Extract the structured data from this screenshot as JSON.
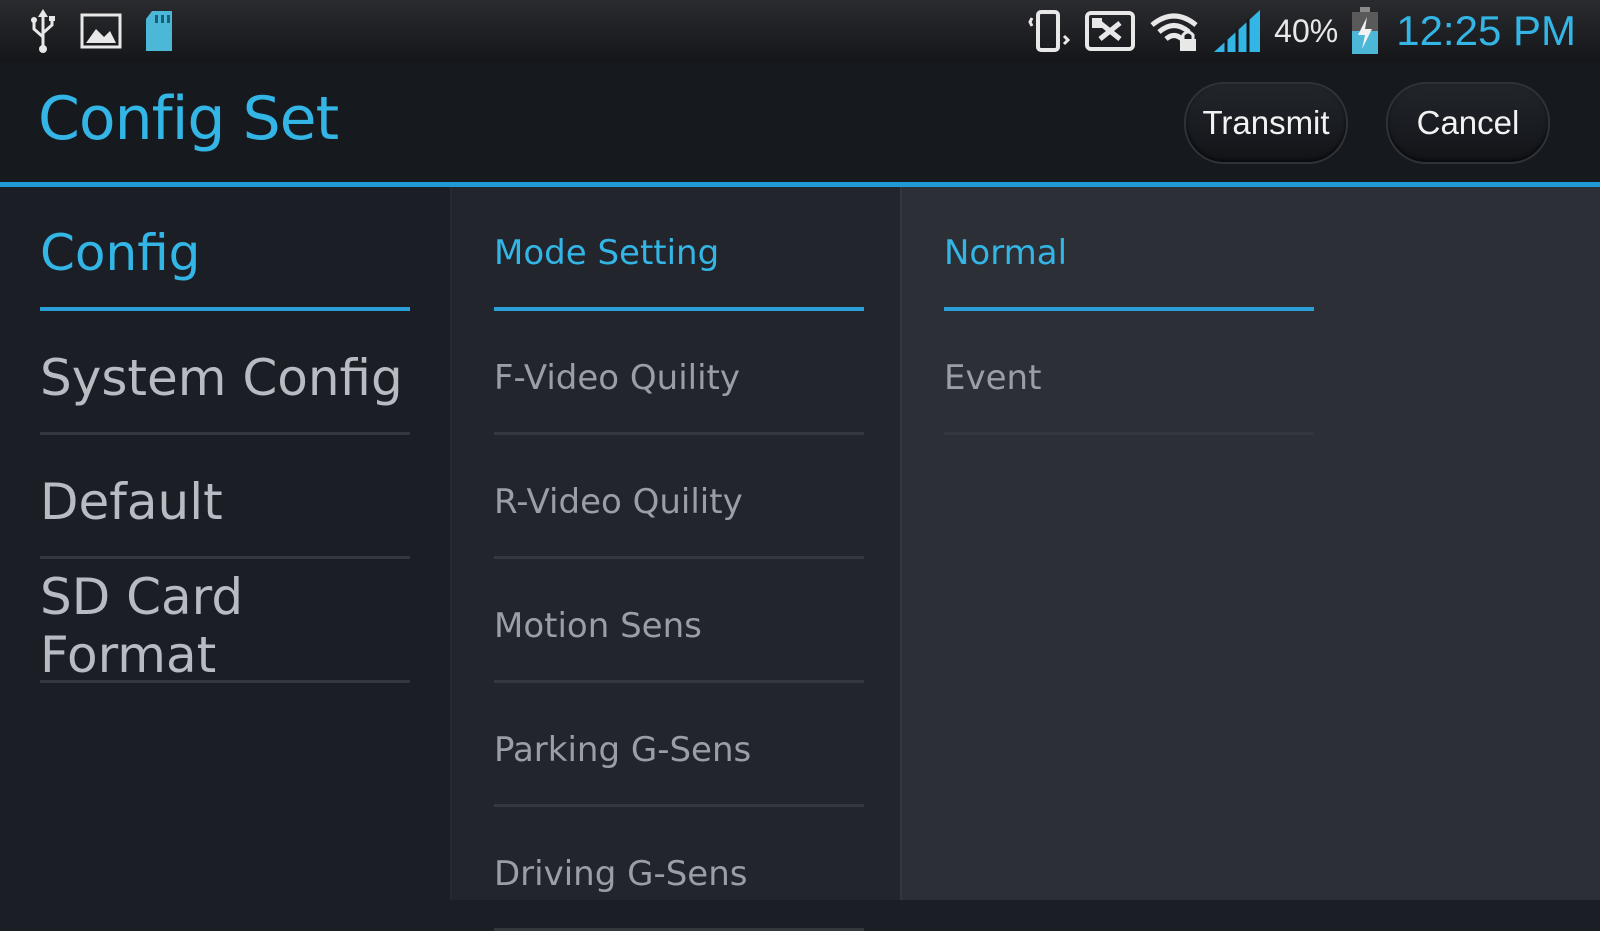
{
  "status_bar": {
    "left_icons": [
      "usb-icon",
      "image-icon",
      "sd-card-icon"
    ],
    "right_icons": [
      "vibrate-icon",
      "screen-off-icon",
      "wifi-lock-icon",
      "signal-icon",
      "battery-charging-icon"
    ],
    "battery_percent": "40%",
    "time": "12:25 PM"
  },
  "action_bar": {
    "title": "Config Set",
    "transmit_label": "Transmit",
    "cancel_label": "Cancel"
  },
  "categories": {
    "items": [
      {
        "label": "Config",
        "selected": true
      },
      {
        "label": "System Config",
        "selected": false
      },
      {
        "label": "Default",
        "selected": false
      },
      {
        "label": "SD Card Format",
        "selected": false
      }
    ]
  },
  "settings": {
    "items": [
      {
        "label": "Mode Setting",
        "selected": true
      },
      {
        "label": "F-Video Quility",
        "selected": false
      },
      {
        "label": "R-Video Quility",
        "selected": false
      },
      {
        "label": "Motion Sens",
        "selected": false
      },
      {
        "label": "Parking G-Sens",
        "selected": false
      },
      {
        "label": "Driving G-Sens",
        "selected": false
      }
    ]
  },
  "options": {
    "items": [
      {
        "label": "Normal",
        "selected": true
      },
      {
        "label": "Event",
        "selected": false
      }
    ]
  },
  "colors": {
    "accent": "#33b5e5",
    "divider_accent": "#1f9ad6",
    "background": "#1b1e24"
  }
}
